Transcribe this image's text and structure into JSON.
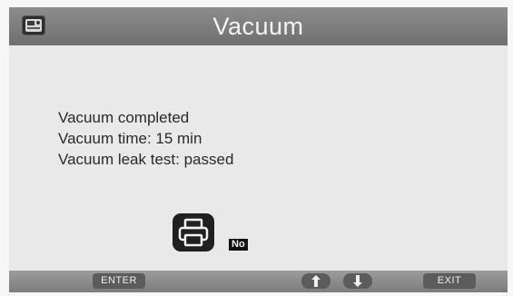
{
  "header": {
    "title": "Vacuum",
    "icon": "app-badge-icon"
  },
  "status": {
    "lines": [
      "Vacuum completed",
      "Vacuum time: 15 min",
      "Vacuum leak test: passed"
    ]
  },
  "print": {
    "icon": "printer-icon",
    "choice": "No"
  },
  "footer": {
    "enter_label": "ENTER",
    "up_icon": "arrow-up-icon",
    "down_icon": "arrow-down-icon",
    "exit_label": "EXIT"
  },
  "colors": {
    "title_bar": "#7a7a7a",
    "panel": "#e9e9e9",
    "footer": "#8a8a8a",
    "text": "#2a2a2a"
  }
}
